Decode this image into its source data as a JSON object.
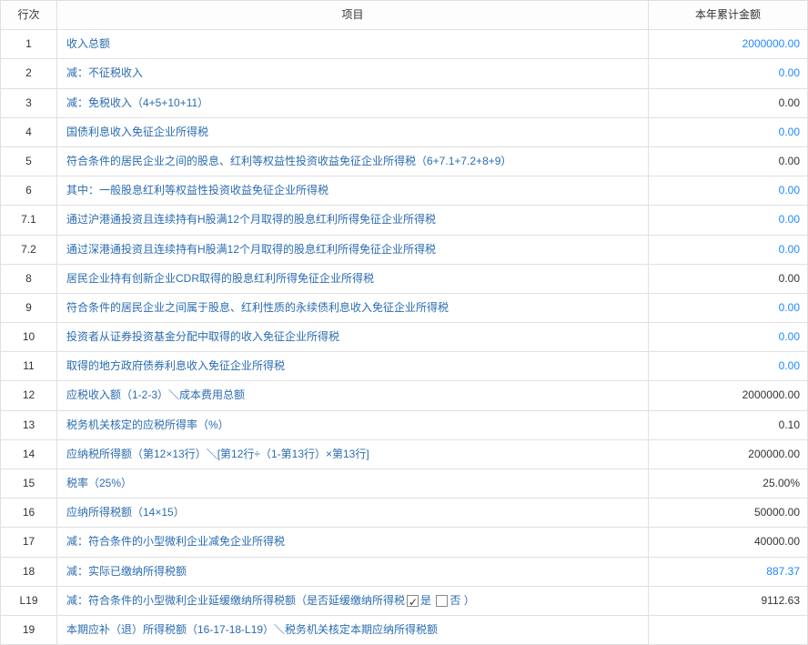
{
  "headers": {
    "rownum": "行次",
    "item": "项目",
    "amount": "本年累计金额"
  },
  "rows": [
    {
      "num": "1",
      "item": "收入总额",
      "amount": "2000000.00",
      "blue": true
    },
    {
      "num": "2",
      "item": "减：不征税收入",
      "amount": "0.00",
      "blue": true
    },
    {
      "num": "3",
      "item": "减：免税收入（4+5+10+11）",
      "amount": "0.00",
      "blue": false
    },
    {
      "num": "4",
      "item": "国债利息收入免征企业所得税",
      "amount": "0.00",
      "blue": true
    },
    {
      "num": "5",
      "item": "符合条件的居民企业之间的股息、红利等权益性投资收益免征企业所得税（6+7.1+7.2+8+9）",
      "amount": "0.00",
      "blue": false
    },
    {
      "num": "6",
      "item": "其中：一般股息红利等权益性投资收益免征企业所得税",
      "amount": "0.00",
      "blue": true
    },
    {
      "num": "7.1",
      "item": "通过沪港通投资且连续持有H股满12个月取得的股息红利所得免征企业所得税",
      "amount": "0.00",
      "blue": true
    },
    {
      "num": "7.2",
      "item": "通过深港通投资且连续持有H股满12个月取得的股息红利所得免征企业所得税",
      "amount": "0.00",
      "blue": true
    },
    {
      "num": "8",
      "item": "居民企业持有创新企业CDR取得的股息红利所得免征企业所得税",
      "amount": "0.00",
      "blue": false
    },
    {
      "num": "9",
      "item": "符合条件的居民企业之间属于股息、红利性质的永续债利息收入免征企业所得税",
      "amount": "0.00",
      "blue": true
    },
    {
      "num": "10",
      "item": "投资者从证券投资基金分配中取得的收入免征企业所得税",
      "amount": "0.00",
      "blue": true
    },
    {
      "num": "11",
      "item": "取得的地方政府债券利息收入免征企业所得税",
      "amount": "0.00",
      "blue": true
    },
    {
      "num": "12",
      "item": "应税收入额（1-2-3）＼成本费用总额",
      "amount": "2000000.00",
      "blue": false
    },
    {
      "num": "13",
      "item": "税务机关核定的应税所得率（%）",
      "amount": "0.10",
      "blue": false
    },
    {
      "num": "14",
      "item": "应纳税所得额（第12×13行）＼[第12行÷（1-第13行）×第13行]",
      "amount": "200000.00",
      "blue": false
    },
    {
      "num": "15",
      "item": "税率（25%）",
      "amount": "25.00%",
      "blue": false
    },
    {
      "num": "16",
      "item": "应纳所得税额（14×15）",
      "amount": "50000.00",
      "blue": false
    },
    {
      "num": "17",
      "item": "减：符合条件的小型微利企业减免企业所得税",
      "amount": "40000.00",
      "blue": false
    },
    {
      "num": "18",
      "item": "减：实际已缴纳所得税额",
      "amount": "887.37",
      "blue": true
    },
    {
      "num": "L19",
      "item": "减：符合条件的小型微利企业延缓缴纳所得税额（是否延缓缴纳所得税",
      "item_suffix_yes": "是",
      "item_suffix_no": "否",
      "item_tail": "）",
      "amount": "9112.63",
      "blue": false,
      "checkboxRow": true
    },
    {
      "num": "19",
      "item": "本期应补（退）所得税额（16-17-18-L19）＼税务机关核定本期应纳所得税额",
      "amount": "",
      "blue": false
    }
  ]
}
